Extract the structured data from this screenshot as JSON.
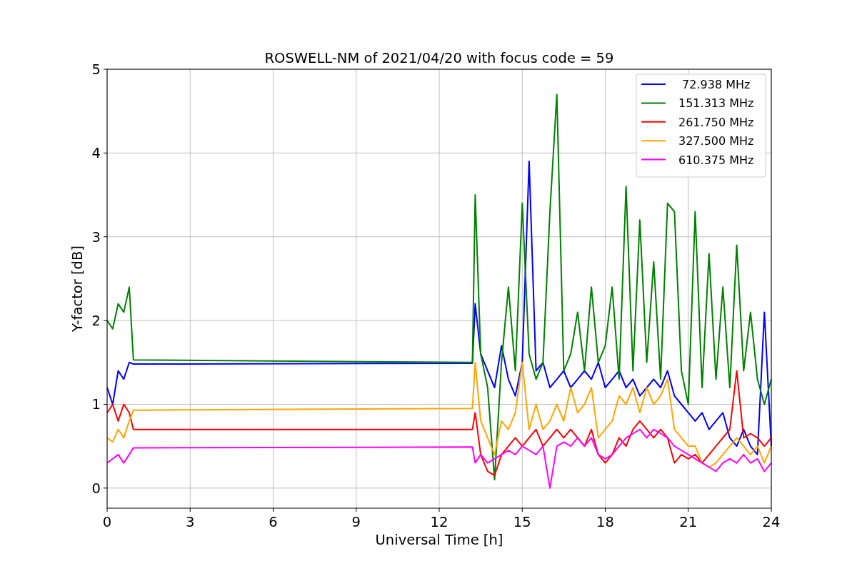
{
  "chart": {
    "chart_data": {
      "type": "line",
      "title": "ROSWELL-NM of 2021/04/20 with focus code = 59",
      "xlabel": "Universal Time [h]",
      "ylabel": "Y-factor [dB]",
      "xlim": [
        0,
        24
      ],
      "ylim": [
        -0.24,
        5
      ],
      "xticks": [
        0,
        3,
        6,
        9,
        12,
        15,
        18,
        21,
        24
      ],
      "yticks": [
        0,
        1,
        2,
        3,
        4,
        5
      ],
      "grid": true,
      "legend": true,
      "x": [
        0,
        0.2,
        0.4,
        0.6,
        0.8,
        0.95,
        13.2,
        13.3,
        13.5,
        13.75,
        14,
        14.25,
        14.5,
        14.75,
        15,
        15.25,
        15.5,
        15.75,
        16,
        16.25,
        16.5,
        16.75,
        17,
        17.25,
        17.5,
        17.75,
        18,
        18.25,
        18.5,
        18.75,
        19,
        19.25,
        19.5,
        19.75,
        20,
        20.25,
        20.5,
        20.75,
        21,
        21.25,
        21.5,
        21.75,
        22,
        22.25,
        22.5,
        22.75,
        23,
        23.25,
        23.5,
        23.75,
        24
      ],
      "series": [
        {
          "name": " 72.938 MHz",
          "color": "#0000ff",
          "values": [
            1.2,
            1.0,
            1.4,
            1.3,
            1.5,
            1.48,
            1.49,
            2.2,
            1.6,
            1.4,
            1.2,
            1.7,
            1.3,
            1.1,
            1.5,
            3.9,
            1.4,
            1.5,
            1.2,
            1.3,
            1.4,
            1.2,
            1.3,
            1.4,
            1.3,
            1.5,
            1.2,
            1.3,
            1.4,
            1.2,
            1.3,
            1.1,
            1.2,
            1.3,
            1.2,
            1.4,
            1.1,
            1.0,
            0.9,
            0.8,
            0.9,
            0.7,
            0.8,
            0.9,
            0.6,
            0.5,
            0.7,
            0.5,
            0.4,
            2.1,
            0.5
          ]
        },
        {
          "name": "151.313 MHz",
          "color": "#008000",
          "values": [
            2.0,
            1.9,
            2.2,
            2.1,
            2.4,
            1.53,
            1.5,
            3.5,
            1.6,
            1.2,
            0.1,
            1.5,
            2.4,
            1.4,
            3.4,
            1.6,
            1.3,
            1.5,
            3.3,
            4.7,
            1.4,
            1.6,
            2.1,
            1.4,
            2.4,
            1.5,
            1.7,
            2.4,
            1.3,
            3.6,
            1.4,
            3.2,
            1.5,
            2.7,
            1.3,
            3.4,
            3.3,
            1.4,
            1.0,
            3.3,
            1.2,
            2.8,
            1.3,
            2.4,
            1.2,
            2.9,
            1.4,
            2.1,
            1.3,
            1.0,
            1.3
          ]
        },
        {
          "name": "261.750 MHz",
          "color": "#ff0000",
          "values": [
            0.9,
            1.0,
            0.8,
            1.0,
            0.9,
            0.7,
            0.7,
            0.9,
            0.4,
            0.2,
            0.15,
            0.4,
            0.5,
            0.6,
            0.5,
            0.6,
            0.7,
            0.5,
            0.6,
            0.7,
            0.6,
            0.7,
            0.6,
            0.5,
            0.7,
            0.4,
            0.3,
            0.4,
            0.6,
            0.5,
            0.7,
            0.8,
            0.7,
            0.6,
            0.7,
            0.6,
            0.3,
            0.4,
            0.35,
            0.4,
            0.3,
            0.4,
            0.5,
            0.6,
            0.7,
            1.4,
            0.6,
            0.65,
            0.6,
            0.5,
            0.6
          ]
        },
        {
          "name": "327.500 MHz",
          "color": "#ffa500",
          "values": [
            0.6,
            0.55,
            0.7,
            0.6,
            0.8,
            0.93,
            0.95,
            1.5,
            0.8,
            0.6,
            0.4,
            0.8,
            0.7,
            0.9,
            1.5,
            0.7,
            1.0,
            0.7,
            0.8,
            1.0,
            0.8,
            1.2,
            0.9,
            1.0,
            1.2,
            0.6,
            0.7,
            0.8,
            1.1,
            1.0,
            1.2,
            0.9,
            1.2,
            1.0,
            1.1,
            1.3,
            0.7,
            0.6,
            0.5,
            0.5,
            0.3,
            0.25,
            0.3,
            0.4,
            0.5,
            0.6,
            0.5,
            0.4,
            0.5,
            0.3,
            0.5
          ]
        },
        {
          "name": "610.375 MHz",
          "color": "#ff00ff",
          "values": [
            0.3,
            0.35,
            0.4,
            0.3,
            0.4,
            0.48,
            0.49,
            0.3,
            0.4,
            0.3,
            0.35,
            0.4,
            0.45,
            0.4,
            0.5,
            0.45,
            0.4,
            0.5,
            0.0,
            0.5,
            0.55,
            0.5,
            0.6,
            0.5,
            0.6,
            0.4,
            0.35,
            0.4,
            0.5,
            0.6,
            0.65,
            0.7,
            0.6,
            0.7,
            0.65,
            0.6,
            0.5,
            0.45,
            0.4,
            0.35,
            0.3,
            0.25,
            0.2,
            0.3,
            0.35,
            0.3,
            0.4,
            0.3,
            0.35,
            0.2,
            0.3
          ]
        }
      ]
    }
  }
}
